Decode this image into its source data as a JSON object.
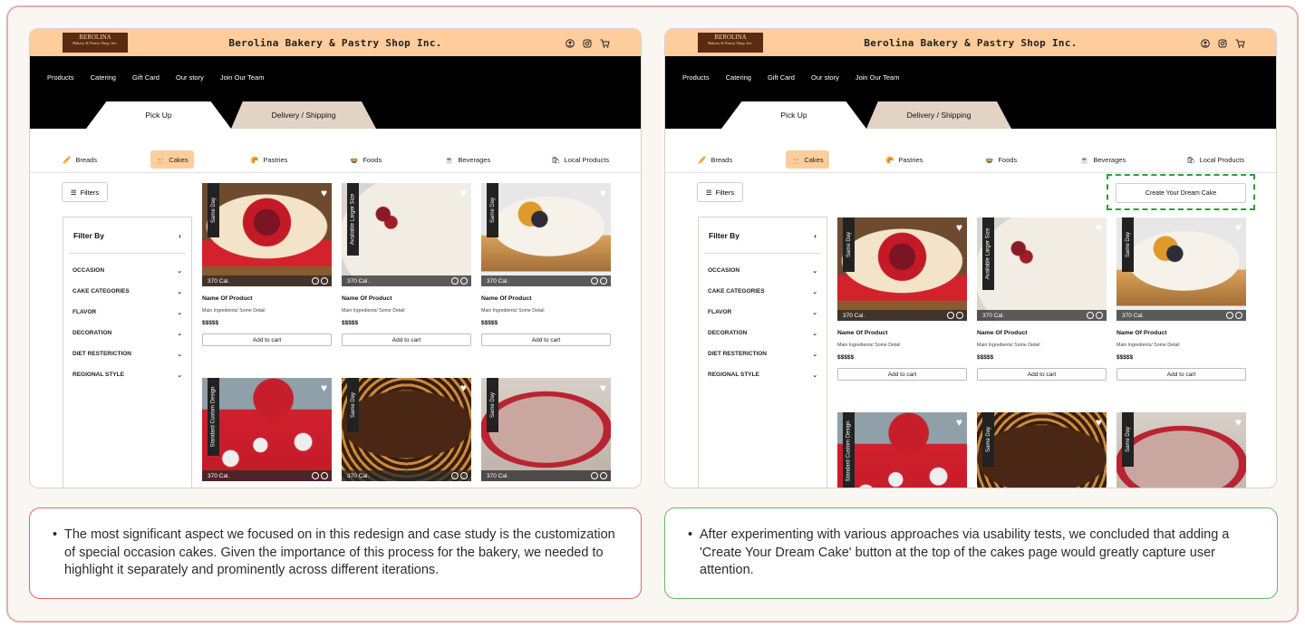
{
  "shop": {
    "logo_top": "BEROLINA",
    "logo_sub": "Bakery & Pastry Shop, Inc.",
    "title": "Berolina Bakery & Pastry Shop Inc.",
    "icons": [
      "user-icon",
      "instagram-icon",
      "cart-icon"
    ]
  },
  "nav": [
    "Products",
    "Catering",
    "Gift Card",
    "Our story",
    "Join Our Team"
  ],
  "tabs": {
    "pickup": "Pick Up",
    "delivery": "Delivery / Shipping"
  },
  "categories": [
    {
      "label": "Breads",
      "icon": "bread-icon"
    },
    {
      "label": "Cakes",
      "icon": "cake-icon",
      "active": true
    },
    {
      "label": "Pastries",
      "icon": "pastry-icon"
    },
    {
      "label": "Foods",
      "icon": "food-icon"
    },
    {
      "label": "Beverages",
      "icon": "beverage-icon"
    },
    {
      "label": "Local Products",
      "icon": "bag-icon"
    }
  ],
  "filters": {
    "button": "Filters",
    "title": "Filter By",
    "items": [
      "OCCASION",
      "CAKE CATEGORIES",
      "FLAVOR",
      "DECORATION",
      "DIET RESTERICTION",
      "REGIONAL STYLE"
    ]
  },
  "products": [
    {
      "badge": "Same Day",
      "cal": "370 Cal.",
      "name": "Name Of Product",
      "desc": "Main Ingredients/ Some Detail",
      "price": "$$$$$",
      "cta": "Add to cart"
    },
    {
      "badge": "Available Larger Size",
      "cal": "370 Cal.",
      "name": "Name Of Product",
      "desc": "Main Ingredients/ Some Detail",
      "price": "$$$$$",
      "cta": "Add to cart"
    },
    {
      "badge": "Same Day",
      "cal": "370 Cal.",
      "name": "Name Of Product",
      "desc": "Main Ingredients/ Some Detail",
      "price": "$$$$$",
      "cta": "Add to cart"
    },
    {
      "badge": "Standard Custom Design",
      "cal": "370 Cal."
    },
    {
      "badge": "Same Day",
      "cal": "370 Cal."
    },
    {
      "badge": "Same Day",
      "cal": "370 Cal."
    }
  ],
  "dream_button": "Create Your Dream Cake",
  "notes": {
    "left": "The most significant aspect we focused on in this redesign and case study is the customization of special occasion cakes. Given the importance of this process for the bakery, we needed to highlight it separately and prominently across different iterations.",
    "right": "After experimenting with various approaches via usability tests, we concluded that adding a 'Create Your Dream Cake' button at the top of the cakes page would greatly capture user attention."
  },
  "colors": {
    "header": "#ffcd9b",
    "nav_bg": "#000000",
    "active_category": "#ffcd9b",
    "highlight": "#23a23a",
    "note_left_border": "#e0686a",
    "note_right_border": "#67b86a"
  }
}
